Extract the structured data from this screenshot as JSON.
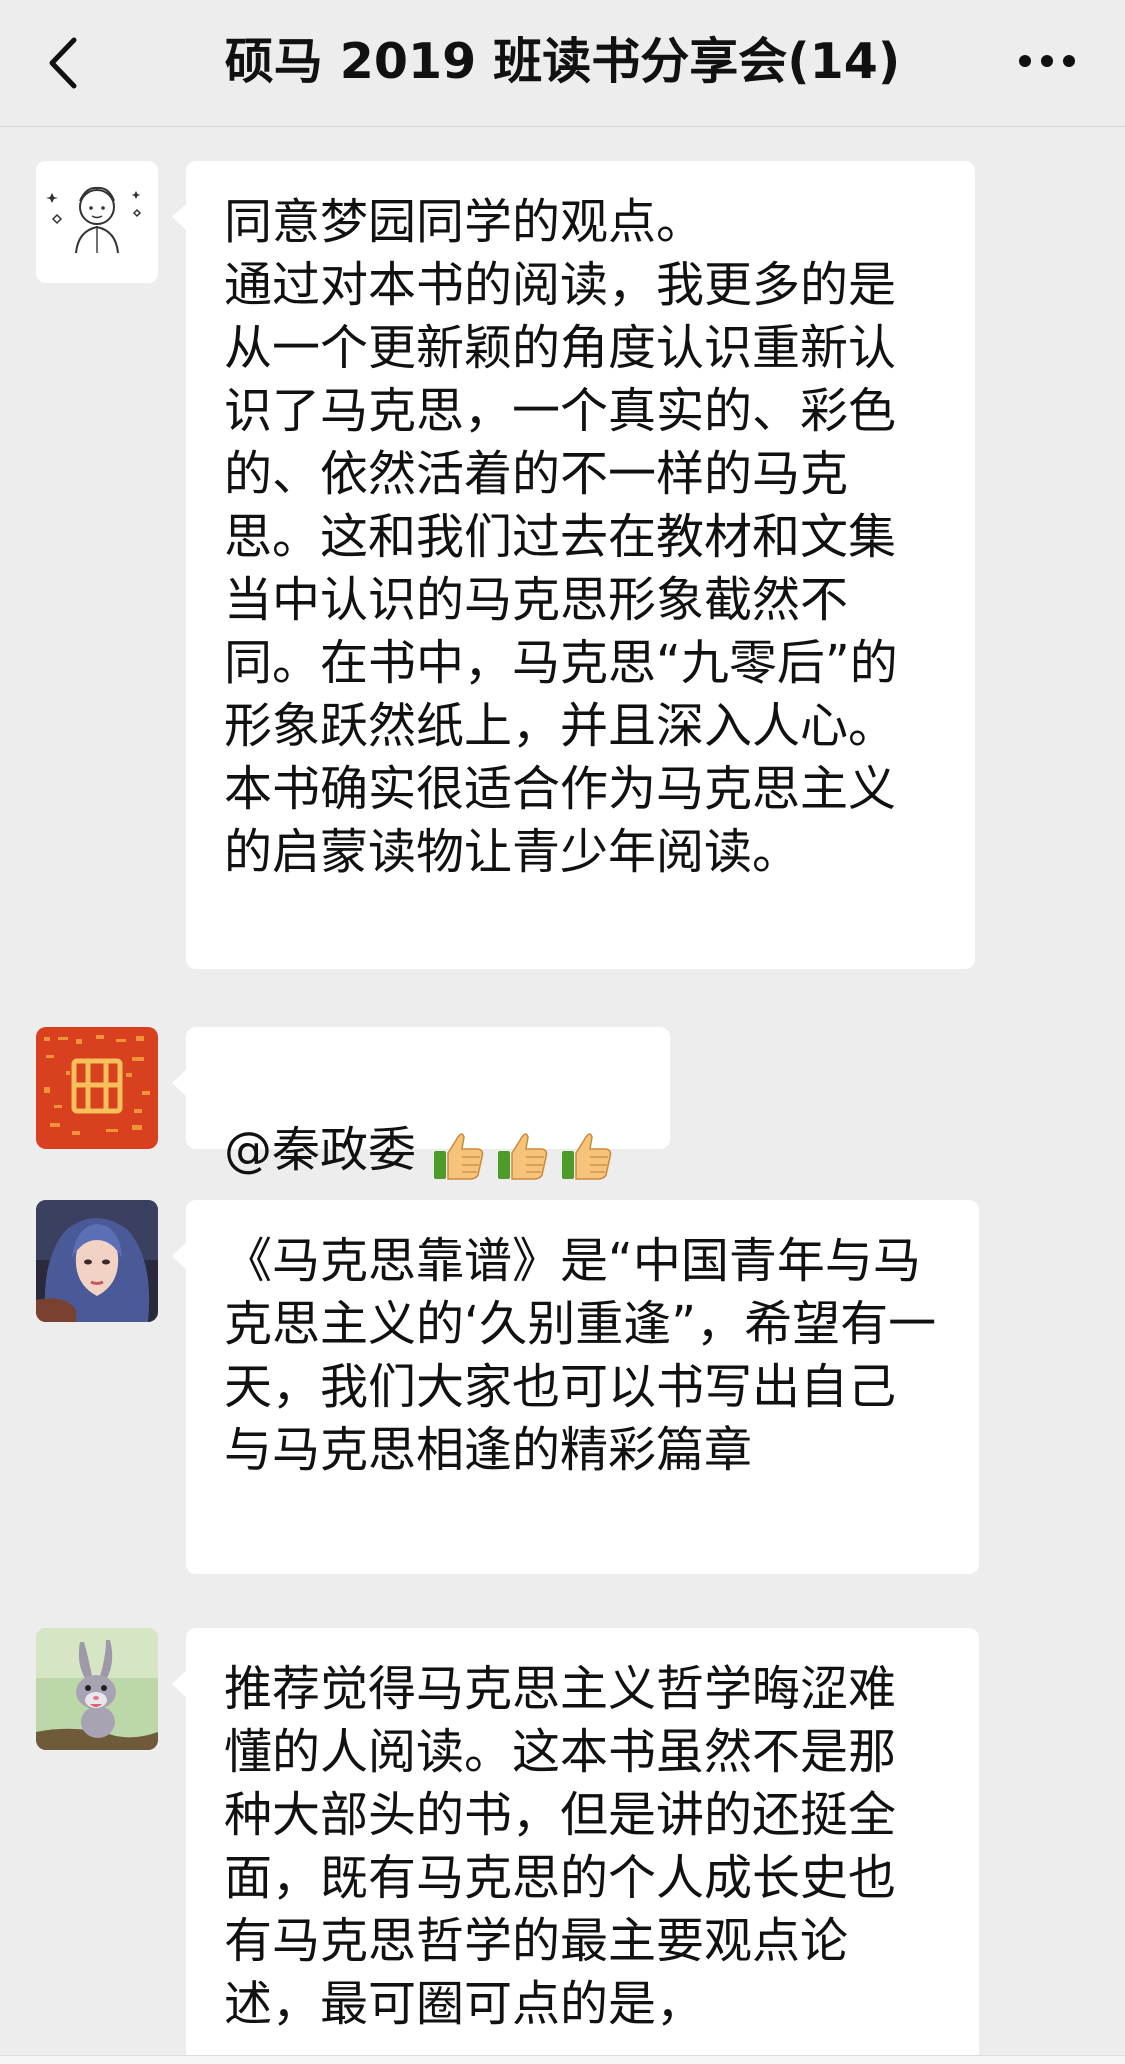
{
  "header": {
    "title": "硕马 2019 班读书分享会(14)"
  },
  "messages": [
    {
      "avatar": "sketch-person-avatar",
      "text": "同意梦园同学的观点。\n通过对本书的阅读，我更多的是从一个更新颖的角度认识重新认识了马克思，一个真实的、彩色的、依然活着的不一样的马克思。这和我们过去在教材和文集当中认识的马克思形象截然不同。在书中，马克思“九零后”的形象跃然纸上，并且深入人心。本书确实很适合作为马克思主义的启蒙读物让青少年阅读。"
    },
    {
      "avatar": "red-pattern-avatar",
      "text": "@秦政委",
      "emojis": [
        "thumbs-up-icon",
        "thumbs-up-icon",
        "thumbs-up-icon"
      ]
    },
    {
      "avatar": "girl-portrait-avatar",
      "text": "《马克思靠谱》是“中国青年与马克思主义的‘久别重逢”，希望有一天，我们大家也可以书写出自己与马克思相逢的精彩篇章"
    },
    {
      "avatar": "rabbit-cartoon-avatar",
      "text": "推荐觉得马克思主义哲学晦涩难懂的人阅读。这本书虽然不是那种大部头的书，但是讲的还挺全面，既有马克思的个人成长史也有马克思哲学的最主要观点论述，最可圈可点的是，"
    }
  ]
}
